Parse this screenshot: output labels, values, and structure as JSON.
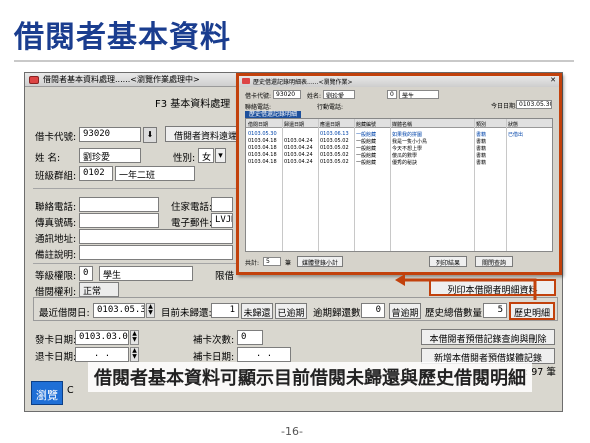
{
  "slide": {
    "title": "借閱者基本資料",
    "caption": "借閱者基本資料可顯示目前借閱未歸還與歷史借閱明細",
    "page": "-16-"
  },
  "main": {
    "window_title": "借閱者基本資料處理......<瀏覽作業處理中>",
    "subtitle": "F3  基本資料處理",
    "card_no_label": "借卡代號:",
    "card_no": "93020",
    "query_btn": "借閱者資料遠端擷",
    "name_label": "姓    名:",
    "name": "劉珍愛",
    "gender_label": "性別:",
    "gender": "女",
    "class_label": "班級群組:",
    "class_code": "0102",
    "class_name": "一年二班",
    "phone_label": "聯絡電話:",
    "home_phone_label": "住家電話:",
    "fax_label": "傳真號碼:",
    "email_label": "電子郵件:",
    "email": "LVJMCCC",
    "address_label": "通訊地址:",
    "remark_label": "備註說明:",
    "level_label": "等級權限:",
    "level_code": "0",
    "level_name": "學生",
    "limit_label": "限借",
    "right_label": "借閱權利:",
    "right": "正常",
    "print_btn": "列印本借閱者明細資料",
    "last_borrow_label": "最近借閱日:",
    "last_borrow": "0103.05.30",
    "unreturned_label": "目前未歸還:",
    "unreturned": "1",
    "unreturned_btn": "未歸還",
    "overdue_btn": "已逾期",
    "overdue_count_label": "逾期歸還數:",
    "overdue_count": "0",
    "overdue_btn2": "曾逾期",
    "history_label": "歷史總借數量:",
    "history_count": "5",
    "history_btn": "歷史明細",
    "issue_date_label": "發卡日期:",
    "issue_date": "0103.03.05",
    "reissue_label": "補卡次數:",
    "reissue_count": "0",
    "cancel_date_label": "退卡日期:",
    "cancel_date": ".  .",
    "reissue_date_label": "補卡日期:",
    "reissue_date": ".  .",
    "reserve_query_btn": "本借閱者預借記錄查詢與刪除",
    "reserve_add_btn": "新增本借閱者預借媒體記錄",
    "browse_btn": "瀏覽",
    "status_left": "C",
    "status_count": ": 97  筆"
  },
  "popup": {
    "title": "歷史借還記錄明細表......<瀏覽作業>",
    "card_label": "借卡代號:",
    "card_no": "93020",
    "name_label": "姓名:",
    "name": "劉珍愛",
    "level_code": "0",
    "level_name": "學生",
    "phone_label": "聯絡電話:",
    "mobile_label": "行動電話:",
    "date_label": "今日日期:",
    "today": "0103.05.30",
    "section": "歷史借還記錄明細",
    "columns": [
      "借閱日期",
      "歸還日期",
      "應還日期",
      "館藏編號",
      "媒體名稱",
      "類別",
      "狀態"
    ],
    "rows": [
      [
        "0103.05.30",
        "",
        "0103.06.13",
        "一般館藏",
        "如果我的拼圖",
        "書籍",
        "已借出"
      ],
      [
        "0103.04.18",
        "0103.04.24",
        "0103.05.02",
        "一般館藏",
        "我是一隻小小鳥",
        "書籍",
        ""
      ],
      [
        "0103.04.18",
        "0103.04.24",
        "0103.05.02",
        "一般館藏",
        "今天不想上學",
        "書籍",
        ""
      ],
      [
        "0103.04.18",
        "0103.04.24",
        "0103.05.02",
        "一般館藏",
        "傻瓜的數學",
        "書籍",
        ""
      ],
      [
        "0103.04.18",
        "0103.04.24",
        "0103.05.02",
        "一般館藏",
        "優秀的秘訣",
        "書籍",
        ""
      ]
    ],
    "total_label": "共計:",
    "total": "5",
    "unit": "筆",
    "sort_btn": "媒體登錄小計",
    "print_btn": "列印結果",
    "close_btn": "關閉查詢"
  },
  "colors": {
    "title": "#1a3d8f",
    "highlight": "#c2410c",
    "blue_button": "#1f6fd6"
  }
}
